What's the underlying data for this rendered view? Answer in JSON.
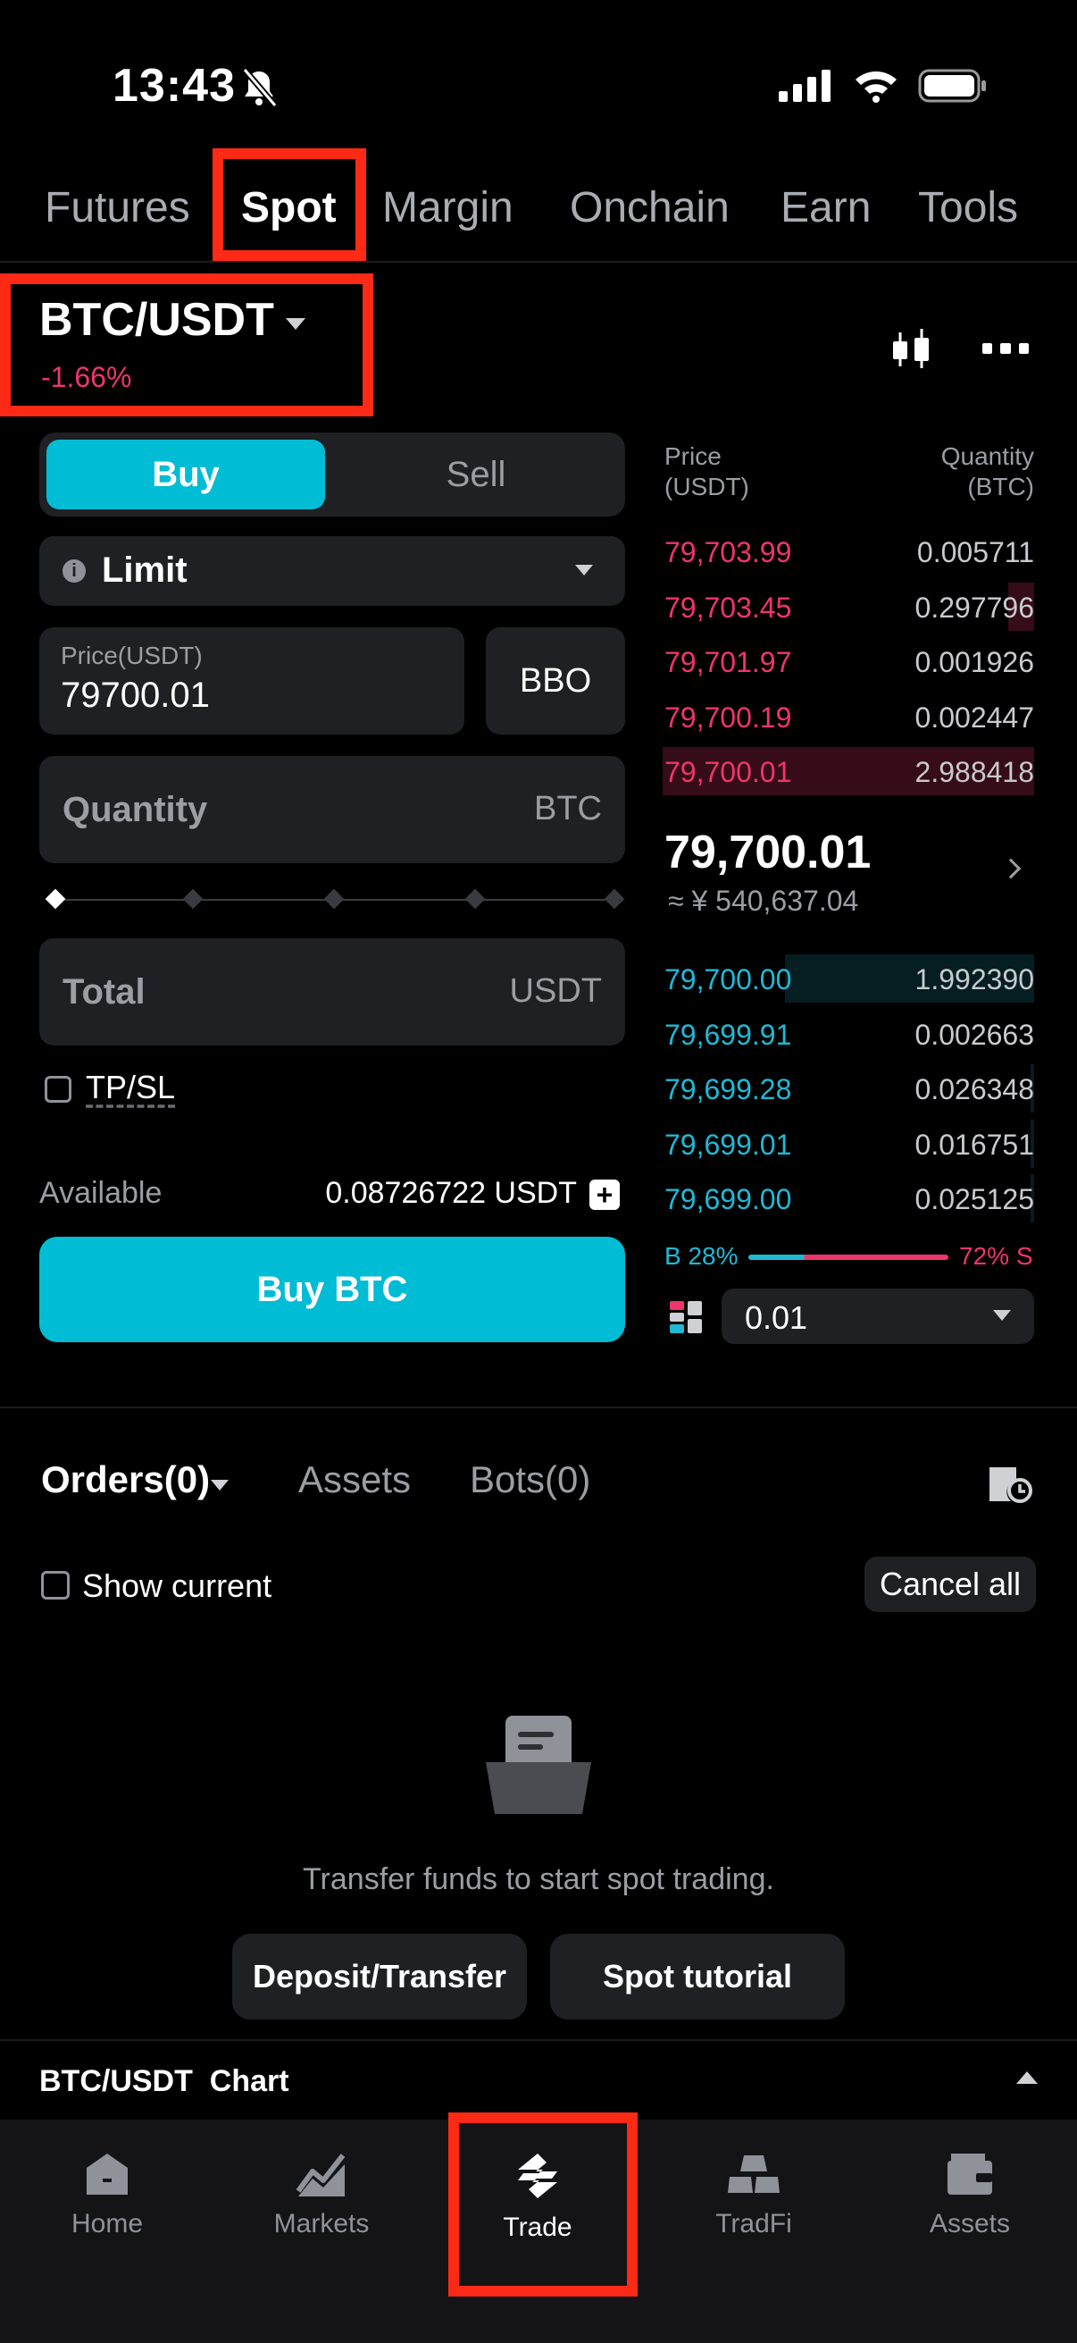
{
  "status_bar": {
    "time": "13:43"
  },
  "top_tabs": [
    {
      "label": "Futures",
      "active": false
    },
    {
      "label": "Spot",
      "active": true
    },
    {
      "label": "Margin",
      "active": false
    },
    {
      "label": "Onchain",
      "active": false
    },
    {
      "label": "Earn",
      "active": false
    },
    {
      "label": "Tools",
      "active": false
    }
  ],
  "pair": {
    "name": "BTC/USDT",
    "change": "-1.66%"
  },
  "order_form": {
    "buy_label": "Buy",
    "sell_label": "Sell",
    "order_type": "Limit",
    "price_label": "Price(USDT)",
    "price_value": "79700.01",
    "bbo_label": "BBO",
    "quantity_placeholder": "Quantity",
    "quantity_unit": "BTC",
    "total_placeholder": "Total",
    "total_unit": "USDT",
    "slider_value_percent": 0,
    "tpsl_label": "TP/SL",
    "available_label": "Available",
    "available_value": "0.08726722 USDT",
    "submit_label": "Buy BTC"
  },
  "order_book": {
    "price_header": "Price\n(USDT)",
    "quantity_header": "Quantity\n(BTC)",
    "asks": [
      {
        "price": "79,703.99",
        "qty": "0.005711",
        "depth": 0
      },
      {
        "price": "79,703.45",
        "qty": "0.297796",
        "depth": 0.07
      },
      {
        "price": "79,701.97",
        "qty": "0.001926",
        "depth": 0
      },
      {
        "price": "79,700.19",
        "qty": "0.002447",
        "depth": 0
      },
      {
        "price": "79,700.01",
        "qty": "2.988418",
        "depth": 1
      }
    ],
    "mid_price": "79,700.01",
    "mid_cny": "≈ ¥ 540,637.04",
    "bids": [
      {
        "price": "79,700.00",
        "qty": "1.992390",
        "depth": 0.67
      },
      {
        "price": "79,699.91",
        "qty": "0.002663",
        "depth": 0
      },
      {
        "price": "79,699.28",
        "qty": "0.026348",
        "depth": 0.01
      },
      {
        "price": "79,699.01",
        "qty": "0.016751",
        "depth": 0.01
      },
      {
        "price": "79,699.00",
        "qty": "0.025125",
        "depth": 0.01
      }
    ],
    "buy_ratio": "B 28%",
    "sell_ratio": "72% S",
    "buy_ratio_value": 28,
    "depth_step": "0.01"
  },
  "orders": {
    "tabs": [
      "Orders(0)",
      "Assets",
      "Bots(0)"
    ],
    "show_current_label": "Show current",
    "cancel_all_label": "Cancel all",
    "empty_text": "Transfer funds to start spot trading.",
    "deposit_label": "Deposit/Transfer",
    "tutorial_label": "Spot tutorial"
  },
  "chart_bar": {
    "label": "BTC/USDT  Chart"
  },
  "bottom_nav": [
    {
      "label": "Home",
      "icon": "home-icon"
    },
    {
      "label": "Markets",
      "icon": "markets-icon"
    },
    {
      "label": "Trade",
      "icon": "trade-icon",
      "active": true
    },
    {
      "label": "TradFi",
      "icon": "tradfi-icon"
    },
    {
      "label": "Assets",
      "icon": "wallet-icon"
    }
  ],
  "colors": {
    "accent": "#00bcd4",
    "ask": "#f0356b",
    "bid": "#1fb9d6",
    "highlight": "#ff2a16"
  }
}
